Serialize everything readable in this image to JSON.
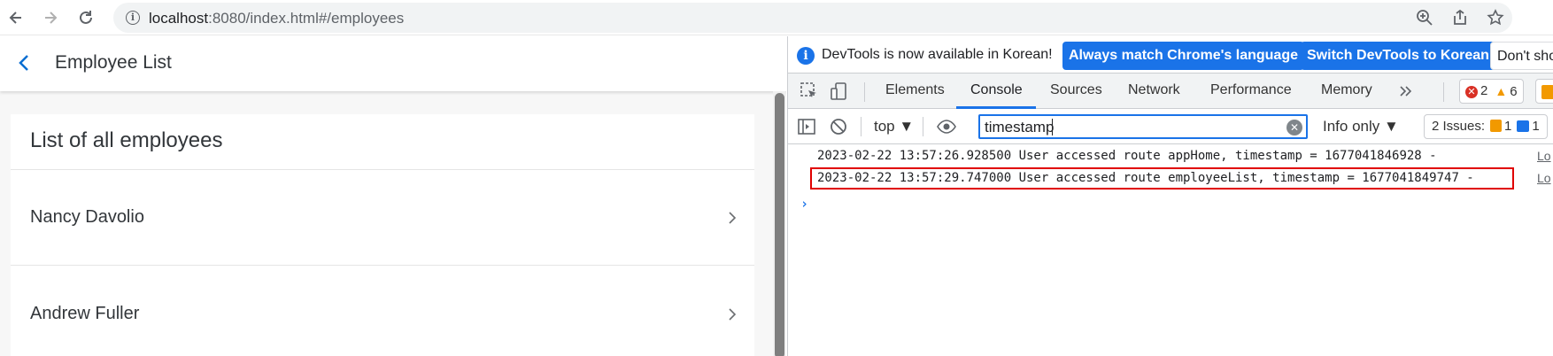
{
  "browser": {
    "url_host": "localhost",
    "url_rest": ":8080/index.html#/employees"
  },
  "app": {
    "title": "Employee List",
    "panel_title": "List of all employees",
    "employees": [
      "Nancy Davolio",
      "Andrew Fuller"
    ]
  },
  "devtools": {
    "notice": {
      "text": "DevTools is now available in Korean!",
      "btn_match": "Always match Chrome's language",
      "btn_switch": "Switch DevTools to Korean",
      "btn_dont": "Don't show"
    },
    "tabs": [
      "Elements",
      "Console",
      "Sources",
      "Network",
      "Performance",
      "Memory"
    ],
    "errors_count": "2",
    "warnings_count": "6",
    "filter": {
      "context": "top",
      "value": "timestamp",
      "levels": "Info only",
      "issues_label": "2 Issues:",
      "issues_warn": "1",
      "issues_info": "1"
    },
    "logs": [
      {
        "text": "2023-02-22 13:57:26.928500 User accessed route appHome, timestamp = 1677041846928 -",
        "source": "Lo"
      },
      {
        "text": "2023-02-22 13:57:29.747000 User accessed route employeeList, timestamp = 1677041849747 -",
        "source": "Lo"
      }
    ],
    "highlight_color": "#e00000"
  }
}
